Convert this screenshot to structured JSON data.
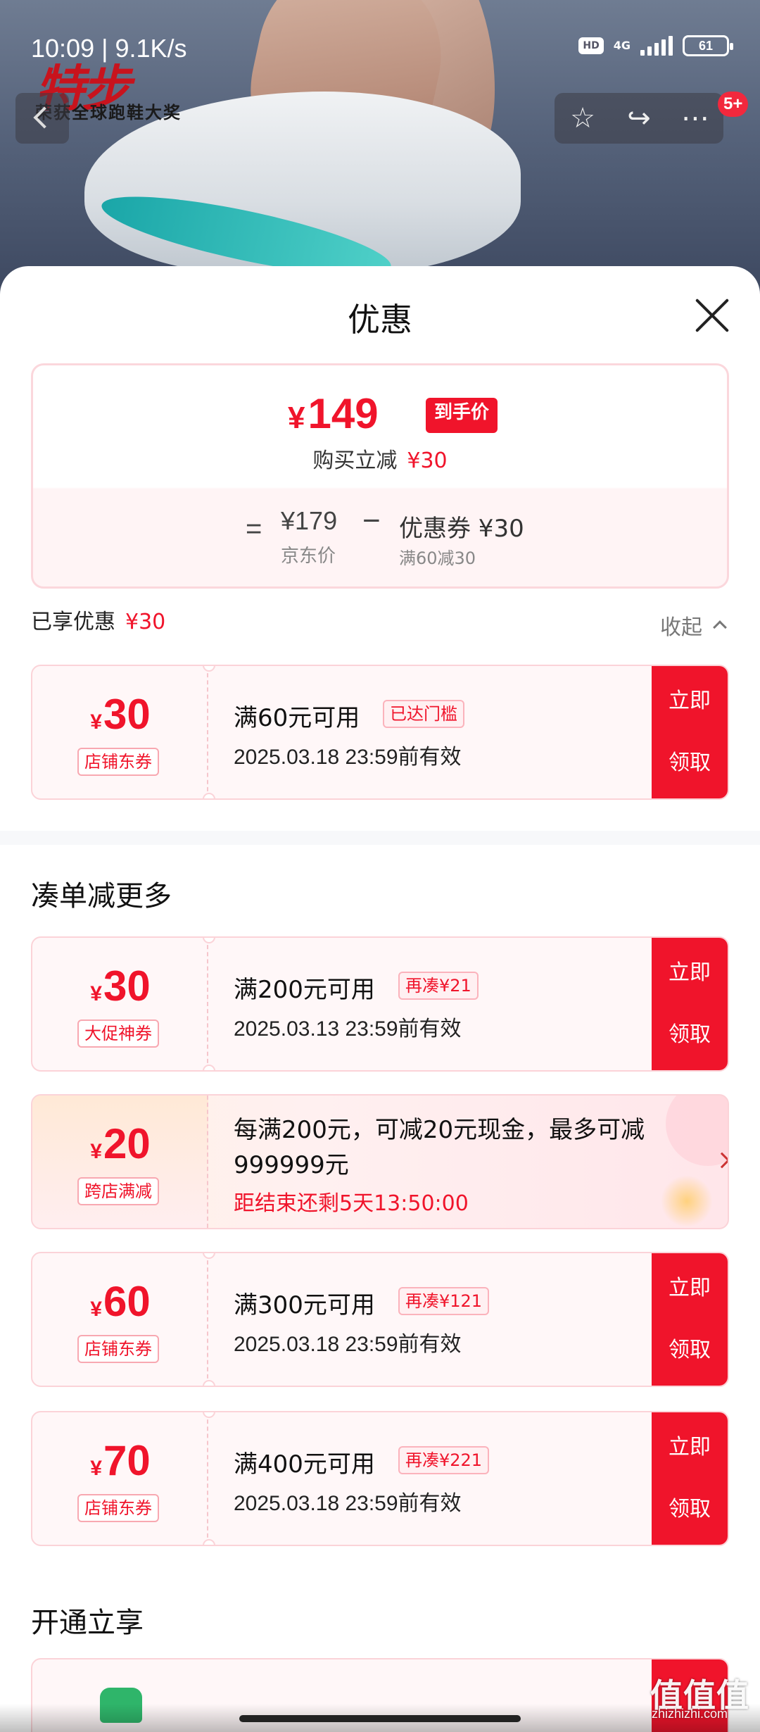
{
  "status": {
    "time": "10:09 | 9.1K/s",
    "hd": "HD",
    "network": "4G",
    "battery": "61"
  },
  "hero": {
    "brand_logo": "特步",
    "brand_tagline": "荣获全球跑鞋大奖",
    "message_badge": "5+",
    "icons": [
      "back-icon",
      "star-icon",
      "share-icon",
      "more-icon"
    ]
  },
  "sheet": {
    "title": "优惠"
  },
  "price_card": {
    "currency": "¥",
    "final_price": "149",
    "final_tag": "到手价",
    "instant_label": "购买立减",
    "instant_amount": "¥30",
    "equals": "=",
    "jd_price": "¥179",
    "jd_label": "京东价",
    "minus": "−",
    "coupon_amount": "优惠券 ¥30",
    "coupon_condition": "满60减30"
  },
  "enjoyed": {
    "label": "已享优惠",
    "amount": "¥30",
    "collapse_label": "收起"
  },
  "applied_coupon": {
    "amount": "30",
    "type": "店铺东券",
    "condition": "满60元可用",
    "chip": "已达门槛",
    "validity": "2025.03.18 23:59前有效",
    "claim": "立即领取"
  },
  "more_section": {
    "title": "凑单减更多",
    "coupons": [
      {
        "amount": "30",
        "type": "大促神券",
        "condition": "满200元可用",
        "chip": "再凑¥21",
        "validity": "2025.03.13 23:59前有效",
        "claim": "立即领取"
      },
      {
        "amount": "60",
        "type": "店铺东券",
        "condition": "满300元可用",
        "chip": "再凑¥121",
        "validity": "2025.03.18 23:59前有效",
        "claim": "立即领取"
      },
      {
        "amount": "70",
        "type": "店铺东券",
        "condition": "满400元可用",
        "chip": "再凑¥221",
        "validity": "2025.03.18 23:59前有效",
        "claim": "立即领取"
      }
    ],
    "promo": {
      "amount": "20",
      "type": "跨店满减",
      "description": "每满200元，可减20元现金，最多可减999999元",
      "countdown": "距结束还剩5天13:50:00"
    }
  },
  "open_section": {
    "title": "开通立享"
  },
  "watermark": {
    "main": "值值值",
    "sub": "zhizhizhi.com"
  },
  "colors": {
    "accent": "#f0142b",
    "card_border": "#fbd3d8",
    "card_bg": "#fff7f8"
  }
}
